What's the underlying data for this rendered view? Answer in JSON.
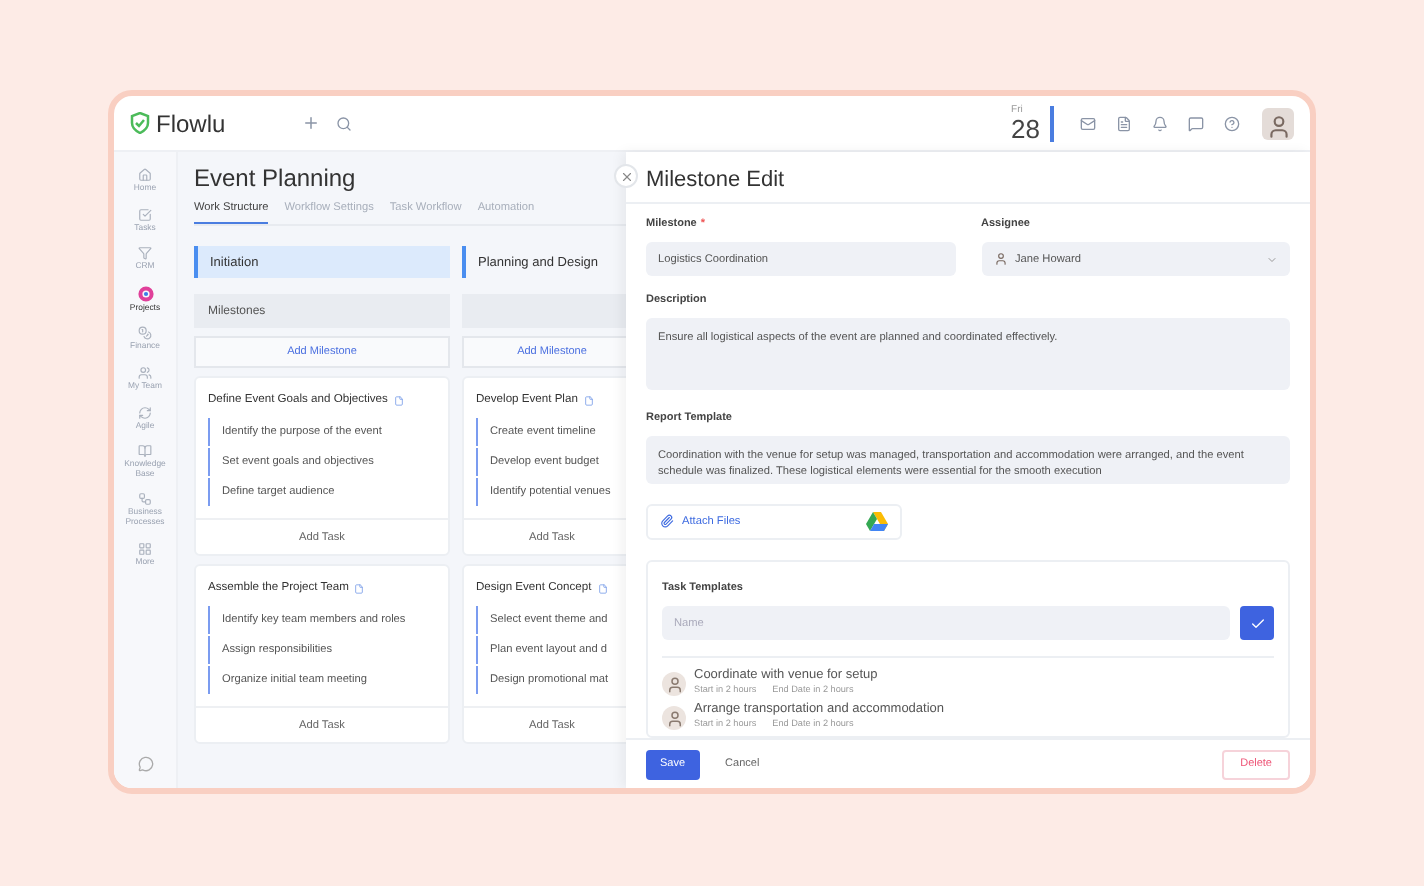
{
  "header": {
    "logo": "Flowlu",
    "day": "Fri",
    "date": "28"
  },
  "sidebar": {
    "items": [
      {
        "label": "Home",
        "selected": false
      },
      {
        "label": "Tasks",
        "selected": false
      },
      {
        "label": "CRM",
        "selected": false
      },
      {
        "label": "Projects",
        "selected": true
      },
      {
        "label": "Finance",
        "selected": false
      },
      {
        "label": "My Team",
        "selected": false
      },
      {
        "label": "Agile",
        "selected": false
      },
      {
        "label": "Knowledge Base",
        "selected": false
      },
      {
        "label": "Business Processes",
        "selected": false
      },
      {
        "label": "More",
        "selected": false
      }
    ]
  },
  "project": {
    "title": "Event Planning",
    "tabs": [
      {
        "label": "Work Structure",
        "selected": true
      },
      {
        "label": "Workflow Settings",
        "selected": false
      },
      {
        "label": "Task Workflow",
        "selected": false
      },
      {
        "label": "Automation",
        "selected": false
      }
    ],
    "milestones_label": "Milestones",
    "columns": [
      {
        "stage": "Initiation",
        "selected": true,
        "add_label": "Add Milestone",
        "cards": [
          {
            "title": "Define Event Goals and Objectives",
            "tasks": [
              "Identify the purpose of the event",
              "Set event goals and objectives",
              "Define target audience"
            ],
            "add_label": "Add Task"
          },
          {
            "title": "Assemble the Project Team",
            "tasks": [
              "Identify key team members and roles",
              "Assign responsibilities",
              "Organize initial team meeting"
            ],
            "add_label": "Add Task"
          }
        ]
      },
      {
        "stage": "Planning and Design",
        "selected": false,
        "add_label": "Add Milestone",
        "cards": [
          {
            "title": "Develop Event Plan",
            "tasks": [
              "Create event timeline",
              "Develop event budget",
              "Identify potential venues"
            ],
            "add_label": "Add Task"
          },
          {
            "title": "Design Event Concept",
            "tasks": [
              "Select event theme and",
              "Plan event layout and d",
              "Design promotional mat"
            ],
            "add_label": "Add Task"
          }
        ]
      }
    ]
  },
  "modal": {
    "title": "Milestone Edit",
    "milestone": {
      "label": "Milestone",
      "required_mark": "*",
      "value": "Logistics Coordination"
    },
    "assignee": {
      "label": "Assignee",
      "value": "Jane Howard"
    },
    "description": {
      "label": "Description",
      "value": "Ensure all logistical aspects of the event are planned and coordinated effectively."
    },
    "report": {
      "label": "Report Template",
      "value": "Coordination with the venue for setup was managed, transportation and accommodation were arranged, and the event schedule was finalized. These logistical elements were essential for the smooth execution"
    },
    "attach_label": "Attach Files",
    "task_templates": {
      "label": "Task Templates",
      "placeholder": "Name",
      "items": [
        {
          "title": "Coordinate with venue for setup",
          "start": "Start in 2 hours",
          "end": "End Date in 2 hours"
        },
        {
          "title": "Arrange transportation and accommodation",
          "start": "Start in 2 hours",
          "end": "End Date in 2 hours"
        }
      ]
    },
    "buttons": {
      "save": "Save",
      "cancel": "Cancel",
      "delete": "Delete"
    }
  }
}
